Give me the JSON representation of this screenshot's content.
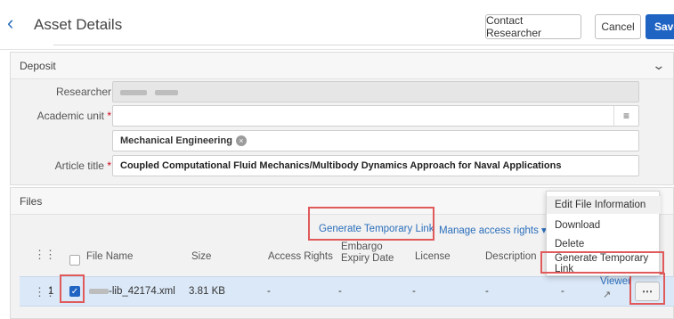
{
  "header": {
    "title": "Asset Details",
    "contact_label": "Contact Researcher",
    "cancel_label": "Cancel",
    "save_label": "Save"
  },
  "deposit": {
    "title": "Deposit",
    "researcher_label": "Researcher",
    "academic_unit_label": "Academic unit",
    "academic_unit_chip": "Mechanical Engineering",
    "article_title_label": "Article title",
    "article_title_value": "Coupled Computational Fluid Mechanics/Multibody Dynamics Approach for Naval Applications",
    "required_mark": "*"
  },
  "files": {
    "title": "Files",
    "toolbar": {
      "generate_link": "Generate Temporary Link",
      "manage_access": "Manage access rights ▾"
    },
    "columns": {
      "file_name": "File Name",
      "size": "Size",
      "access_rights": "Access Rights",
      "embargo": "Embargo Expiry Date",
      "license": "License",
      "description": "Description"
    },
    "row": {
      "index": "1",
      "file_name_suffix": "-lib_42174.xml",
      "size": "3.81 KB",
      "access_rights": "-",
      "embargo": "-",
      "license": "-",
      "description": "-",
      "extra": "-",
      "viewer": "Viewer"
    }
  },
  "menu": {
    "items": [
      "Edit File Information",
      "Download",
      "Delete",
      "Generate Temporary Link"
    ]
  },
  "icons": {
    "back": "chevron-left-icon",
    "collapse": "chevron-down-icon",
    "list": "list-icon",
    "remove": "close-circle-icon",
    "drag": "drag-handle-icon",
    "external": "external-link-icon",
    "more": "more-icon"
  },
  "colors": {
    "accent": "#2064c3",
    "link": "#2a6ebb",
    "highlight": "#e05a5a",
    "selected_row": "#dbe8f7"
  }
}
